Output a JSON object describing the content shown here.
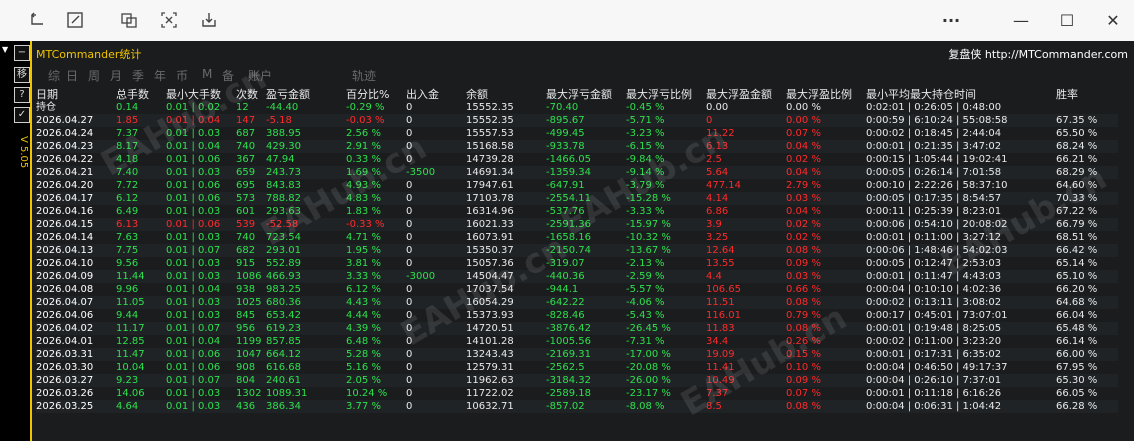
{
  "panel": {
    "title": "MTCommander统计",
    "right_text": "复盘侠 http://MTCommander.com",
    "version": "V 5.05",
    "tabs": [
      "综",
      "日",
      "周",
      "月",
      "季",
      "年",
      "币",
      "M",
      "备",
      "账户",
      "轨迹"
    ],
    "watermarks": [
      "EAHub.cn",
      "EAHub.cn",
      "EAHub.cn",
      "EAHub.cn",
      "EAHub.cn",
      "EAHub.cn"
    ]
  },
  "columns": [
    "日期",
    "总手数",
    "最小大手数",
    "次数",
    "盈亏金额",
    "百分比%",
    "出入金",
    "余额",
    "最大浮亏金额",
    "最大浮亏比例",
    "最大浮盈金额",
    "最大浮盈比例",
    "最小平均最大持仓时间",
    "胜率"
  ],
  "holding": {
    "label": "持仓",
    "total_lots": "0.14",
    "min_max_lots": "0.01 | 0.02",
    "count": "12",
    "pnl": "-44.40",
    "pct": "-0.29 %",
    "cash": "0",
    "balance": "15552.35",
    "max_float_loss": "-70.40",
    "max_float_loss_pct": "-0.45 %",
    "max_float_profit": "0.00",
    "max_float_profit_pct": "0.00 %",
    "hold_time": "0:02:01 | 0:26:05 | 0:48:00",
    "win_rate": ""
  },
  "rows": [
    {
      "date": "2026.04.27",
      "lots": "1.85",
      "minmax": "0.01 | 0.04",
      "count": "147",
      "pnl": "-5.18",
      "pct": "-0.03 %",
      "cash": "0",
      "balance": "15552.35",
      "mfl": "-895.67",
      "mflp": "-5.71 %",
      "mfp": "0",
      "mfpp": "0.00 %",
      "time": "0:00:59 | 6:10:24 | 55:08:58",
      "win": "67.35 %",
      "sign": "neg"
    },
    {
      "date": "2026.04.24",
      "lots": "7.37",
      "minmax": "0.01 | 0.03",
      "count": "687",
      "pnl": "388.95",
      "pct": "2.56 %",
      "cash": "0",
      "balance": "15557.53",
      "mfl": "-499.45",
      "mflp": "-3.23 %",
      "mfp": "11.22",
      "mfpp": "0.07 %",
      "time": "0:00:02 | 0:18:45 | 2:44:04",
      "win": "65.50 %",
      "sign": "pos"
    },
    {
      "date": "2026.04.23",
      "lots": "8.17",
      "minmax": "0.01 | 0.04",
      "count": "740",
      "pnl": "429.30",
      "pct": "2.91 %",
      "cash": "0",
      "balance": "15168.58",
      "mfl": "-933.78",
      "mflp": "-6.15 %",
      "mfp": "6.13",
      "mfpp": "0.04 %",
      "time": "0:00:01 | 0:21:35 | 3:47:02",
      "win": "68.24 %",
      "sign": "pos"
    },
    {
      "date": "2026.04.22",
      "lots": "4.18",
      "minmax": "0.01 | 0.06",
      "count": "367",
      "pnl": "47.94",
      "pct": "0.33 %",
      "cash": "0",
      "balance": "14739.28",
      "mfl": "-1466.05",
      "mflp": "-9.84 %",
      "mfp": "2.5",
      "mfpp": "0.02 %",
      "time": "0:00:15 | 1:05:44 | 19:02:41",
      "win": "66.21 %",
      "sign": "pos"
    },
    {
      "date": "2026.04.21",
      "lots": "7.40",
      "minmax": "0.01 | 0.03",
      "count": "659",
      "pnl": "243.73",
      "pct": "1.69 %",
      "cash": "-3500",
      "balance": "14691.34",
      "mfl": "-1359.34",
      "mflp": "-9.14 %",
      "mfp": "5.64",
      "mfpp": "0.04 %",
      "time": "0:00:05 | 0:26:14 | 7:01:58",
      "win": "68.29 %",
      "sign": "pos"
    },
    {
      "date": "2026.04.20",
      "lots": "7.72",
      "minmax": "0.01 | 0.06",
      "count": "695",
      "pnl": "843.83",
      "pct": "4.93 %",
      "cash": "0",
      "balance": "17947.61",
      "mfl": "-647.91",
      "mflp": "-3.79 %",
      "mfp": "477.14",
      "mfpp": "2.79 %",
      "time": "0:00:10 | 2:22:26 | 58:37:10",
      "win": "64.60 %",
      "sign": "pos"
    },
    {
      "date": "2026.04.17",
      "lots": "6.12",
      "minmax": "0.01 | 0.06",
      "count": "573",
      "pnl": "788.82",
      "pct": "4.83 %",
      "cash": "0",
      "balance": "17103.78",
      "mfl": "-2554.11",
      "mflp": "-15.28 %",
      "mfp": "4.14",
      "mfpp": "0.03 %",
      "time": "0:00:05 | 0:17:35 | 8:54:57",
      "win": "70.33 %",
      "sign": "pos"
    },
    {
      "date": "2026.04.16",
      "lots": "6.49",
      "minmax": "0.01 | 0.03",
      "count": "601",
      "pnl": "293.63",
      "pct": "1.83 %",
      "cash": "0",
      "balance": "16314.96",
      "mfl": "-537.76",
      "mflp": "-3.33 %",
      "mfp": "6.86",
      "mfpp": "0.04 %",
      "time": "0:00:11 | 0:25:39 | 8:23:01",
      "win": "67.22 %",
      "sign": "pos"
    },
    {
      "date": "2026.04.15",
      "lots": "6.13",
      "minmax": "0.01 | 0.06",
      "count": "539",
      "pnl": "-52.58",
      "pct": "-0.33 %",
      "cash": "0",
      "balance": "16021.33",
      "mfl": "-2591.36",
      "mflp": "-15.97 %",
      "mfp": "3.9",
      "mfpp": "0.02 %",
      "time": "0:00:06 | 0:54:10 | 20:08:02",
      "win": "66.79 %",
      "sign": "neg"
    },
    {
      "date": "2026.04.14",
      "lots": "7.63",
      "minmax": "0.01 | 0.03",
      "count": "740",
      "pnl": "723.54",
      "pct": "4.71 %",
      "cash": "0",
      "balance": "16073.91",
      "mfl": "-1658.16",
      "mflp": "-10.32 %",
      "mfp": "3.25",
      "mfpp": "0.02 %",
      "time": "0:00:01 | 0:11:00 | 3:27:12",
      "win": "68.51 %",
      "sign": "pos"
    },
    {
      "date": "2026.04.13",
      "lots": "7.75",
      "minmax": "0.01 | 0.07",
      "count": "682",
      "pnl": "293.01",
      "pct": "1.95 %",
      "cash": "0",
      "balance": "15350.37",
      "mfl": "-2150.74",
      "mflp": "-13.67 %",
      "mfp": "12.64",
      "mfpp": "0.08 %",
      "time": "0:00:06 | 1:48:46 | 54:02:03",
      "win": "66.42 %",
      "sign": "pos"
    },
    {
      "date": "2026.04.10",
      "lots": "9.56",
      "minmax": "0.01 | 0.03",
      "count": "915",
      "pnl": "552.89",
      "pct": "3.81 %",
      "cash": "0",
      "balance": "15057.36",
      "mfl": "-319.07",
      "mflp": "-2.13 %",
      "mfp": "13.55",
      "mfpp": "0.09 %",
      "time": "0:00:05 | 0:12:47 | 2:53:03",
      "win": "65.14 %",
      "sign": "pos"
    },
    {
      "date": "2026.04.09",
      "lots": "11.44",
      "minmax": "0.01 | 0.03",
      "count": "1086",
      "pnl": "466.93",
      "pct": "3.33 %",
      "cash": "-3000",
      "balance": "14504.47",
      "mfl": "-440.36",
      "mflp": "-2.59 %",
      "mfp": "4.4",
      "mfpp": "0.03 %",
      "time": "0:00:01 | 0:11:47 | 4:43:03",
      "win": "65.10 %",
      "sign": "pos"
    },
    {
      "date": "2026.04.08",
      "lots": "9.96",
      "minmax": "0.01 | 0.04",
      "count": "938",
      "pnl": "983.25",
      "pct": "6.12 %",
      "cash": "0",
      "balance": "17037.54",
      "mfl": "-944.1",
      "mflp": "-5.57 %",
      "mfp": "106.65",
      "mfpp": "0.66 %",
      "time": "0:00:04 | 0:10:10 | 4:02:36",
      "win": "66.20 %",
      "sign": "pos"
    },
    {
      "date": "2026.04.07",
      "lots": "11.05",
      "minmax": "0.01 | 0.03",
      "count": "1025",
      "pnl": "680.36",
      "pct": "4.43 %",
      "cash": "0",
      "balance": "16054.29",
      "mfl": "-642.22",
      "mflp": "-4.06 %",
      "mfp": "11.51",
      "mfpp": "0.08 %",
      "time": "0:00:02 | 0:13:11 | 3:08:02",
      "win": "64.68 %",
      "sign": "pos"
    },
    {
      "date": "2026.04.06",
      "lots": "9.44",
      "minmax": "0.01 | 0.03",
      "count": "845",
      "pnl": "653.42",
      "pct": "4.44 %",
      "cash": "0",
      "balance": "15373.93",
      "mfl": "-828.46",
      "mflp": "-5.43 %",
      "mfp": "116.01",
      "mfpp": "0.79 %",
      "time": "0:00:17 | 0:45:01 | 73:07:01",
      "win": "66.04 %",
      "sign": "pos"
    },
    {
      "date": "2026.04.02",
      "lots": "11.17",
      "minmax": "0.01 | 0.07",
      "count": "956",
      "pnl": "619.23",
      "pct": "4.39 %",
      "cash": "0",
      "balance": "14720.51",
      "mfl": "-3876.42",
      "mflp": "-26.45 %",
      "mfp": "11.83",
      "mfpp": "0.08 %",
      "time": "0:00:01 | 0:19:48 | 8:25:05",
      "win": "65.48 %",
      "sign": "pos"
    },
    {
      "date": "2026.04.01",
      "lots": "12.85",
      "minmax": "0.01 | 0.04",
      "count": "1199",
      "pnl": "857.85",
      "pct": "6.48 %",
      "cash": "0",
      "balance": "14101.28",
      "mfl": "-1005.56",
      "mflp": "-7.31 %",
      "mfp": "34.4",
      "mfpp": "0.26 %",
      "time": "0:00:02 | 0:11:00 | 3:23:20",
      "win": "66.14 %",
      "sign": "pos"
    },
    {
      "date": "2026.03.31",
      "lots": "11.47",
      "minmax": "0.01 | 0.06",
      "count": "1047",
      "pnl": "664.12",
      "pct": "5.28 %",
      "cash": "0",
      "balance": "13243.43",
      "mfl": "-2169.31",
      "mflp": "-17.00 %",
      "mfp": "19.09",
      "mfpp": "0.15 %",
      "time": "0:00:01 | 0:17:31 | 6:35:02",
      "win": "66.00 %",
      "sign": "pos"
    },
    {
      "date": "2026.03.30",
      "lots": "10.04",
      "minmax": "0.01 | 0.06",
      "count": "908",
      "pnl": "616.68",
      "pct": "5.16 %",
      "cash": "0",
      "balance": "12579.31",
      "mfl": "-2562.5",
      "mflp": "-20.08 %",
      "mfp": "11.41",
      "mfpp": "0.10 %",
      "time": "0:00:04 | 0:46:50 | 49:17:37",
      "win": "67.95 %",
      "sign": "pos"
    },
    {
      "date": "2026.03.27",
      "lots": "9.23",
      "minmax": "0.01 | 0.07",
      "count": "804",
      "pnl": "240.61",
      "pct": "2.05 %",
      "cash": "0",
      "balance": "11962.63",
      "mfl": "-3184.32",
      "mflp": "-26.00 %",
      "mfp": "10.49",
      "mfpp": "0.09 %",
      "time": "0:00:04 | 0:26:10 | 7:37:01",
      "win": "65.30 %",
      "sign": "pos"
    },
    {
      "date": "2026.03.26",
      "lots": "14.06",
      "minmax": "0.01 | 0.03",
      "count": "1302",
      "pnl": "1089.31",
      "pct": "10.24 %",
      "cash": "0",
      "balance": "11722.02",
      "mfl": "-2589.18",
      "mflp": "-23.17 %",
      "mfp": "7.37",
      "mfpp": "0.07 %",
      "time": "0:00:01 | 0:11:18 | 6:16:26",
      "win": "66.05 %",
      "sign": "pos"
    },
    {
      "date": "2026.03.25",
      "lots": "4.64",
      "minmax": "0.01 | 0.03",
      "count": "436",
      "pnl": "386.34",
      "pct": "3.77 %",
      "cash": "0",
      "balance": "10632.71",
      "mfl": "-857.02",
      "mflp": "-8.08 %",
      "mfp": "8.5",
      "mfpp": "0.08 %",
      "time": "0:00:04 | 0:06:31 | 1:04:42",
      "win": "66.28 %",
      "sign": "pos"
    }
  ]
}
